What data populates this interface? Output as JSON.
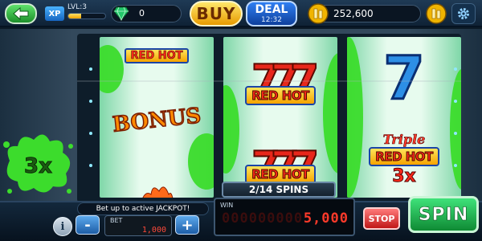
{
  "topbar": {
    "xp_badge": "XP",
    "level_label": "LVL:3",
    "xp_progress": 0.35,
    "gems": "0",
    "buy_label": "BUY",
    "deal_label": "DEAL",
    "deal_timer": "12:32",
    "coins": "252,600"
  },
  "reels": {
    "reel1": {
      "top": "RED HOT",
      "middle": "BONUS"
    },
    "reel2": {
      "top": "RED HOT",
      "bottom": "RED HOT"
    },
    "reel3": {
      "top": "7",
      "triple": "Triple",
      "bottom": "RED HOT",
      "mult": "3x"
    }
  },
  "splash_multiplier": "3x",
  "bottom": {
    "spins": "2/14 SPINS",
    "jackpot_message": "Bet up to active JACKPOT!",
    "info_label": "i",
    "minus_label": "-",
    "plus_label": "+",
    "bet_label": "BET",
    "bet_value": "1,000",
    "win_label": "WIN",
    "win_value": "5,000",
    "stop_label": "STOP",
    "spin_label": "SPIN"
  },
  "colors": {
    "splat_green": "#3cdc2c",
    "spin_green": "#0f8a34",
    "buy_gold": "#e79a00",
    "deal_blue": "#0e3f9c",
    "seven_red": "#e8271b",
    "seven_blue": "#2d8fe6"
  }
}
